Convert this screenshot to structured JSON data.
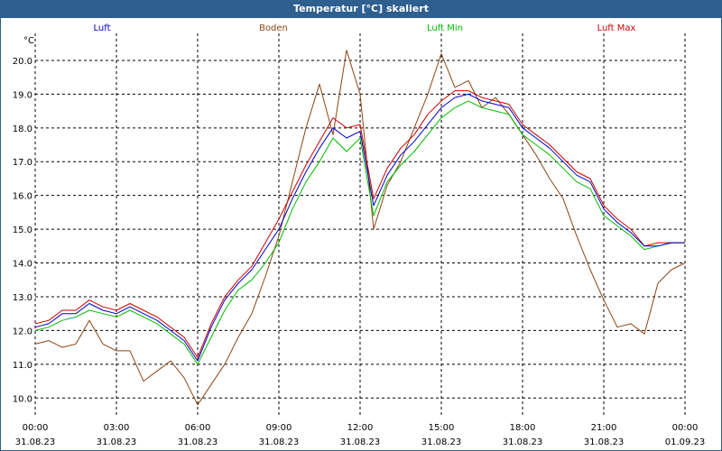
{
  "window": {
    "title": "Temperatur [°C] skaliert"
  },
  "legend": [
    {
      "label": "Luft",
      "color": "#0000cc"
    },
    {
      "label": "Boden",
      "color": "#8b4513"
    },
    {
      "label": "Luft Min",
      "color": "#00bb00"
    },
    {
      "label": "Luft Max",
      "color": "#cc0000"
    }
  ],
  "chart_data": {
    "type": "line",
    "ylabel": "°C",
    "ylim": [
      9.5,
      20.8
    ],
    "y_ticks": [
      "10.0",
      "11.0",
      "12.0",
      "13.0",
      "14.0",
      "15.0",
      "16.0",
      "17.0",
      "18.0",
      "19.0",
      "20.0"
    ],
    "xlim": [
      0,
      24
    ],
    "x_ticks": [
      {
        "time": "00:00",
        "date": "31.08.23"
      },
      {
        "time": "03:00",
        "date": "31.08.23"
      },
      {
        "time": "06:00",
        "date": "31.08.23"
      },
      {
        "time": "09:00",
        "date": "31.08.23"
      },
      {
        "time": "12:00",
        "date": "31.08.23"
      },
      {
        "time": "15:00",
        "date": "31.08.23"
      },
      {
        "time": "18:00",
        "date": "31.08.23"
      },
      {
        "time": "21:00",
        "date": "31.08.23"
      },
      {
        "time": "00:00",
        "date": "01.09.23"
      }
    ],
    "grid": true,
    "series": [
      {
        "name": "Luft",
        "color": "#0000cc",
        "points": [
          [
            0,
            12.1
          ],
          [
            0.5,
            12.2
          ],
          [
            1,
            12.5
          ],
          [
            1.5,
            12.5
          ],
          [
            2,
            12.8
          ],
          [
            2.5,
            12.6
          ],
          [
            3,
            12.5
          ],
          [
            3.5,
            12.7
          ],
          [
            4,
            12.5
          ],
          [
            4.5,
            12.3
          ],
          [
            5,
            12.0
          ],
          [
            5.5,
            11.7
          ],
          [
            6,
            11.1
          ],
          [
            6.5,
            12.1
          ],
          [
            7,
            12.9
          ],
          [
            7.5,
            13.4
          ],
          [
            8,
            13.8
          ],
          [
            8.5,
            14.4
          ],
          [
            9,
            15.0
          ],
          [
            9.5,
            15.9
          ],
          [
            10,
            16.7
          ],
          [
            10.5,
            17.4
          ],
          [
            11,
            18.0
          ],
          [
            11.5,
            17.7
          ],
          [
            12,
            17.9
          ],
          [
            12.5,
            15.7
          ],
          [
            13,
            16.6
          ],
          [
            13.5,
            17.2
          ],
          [
            14,
            17.6
          ],
          [
            14.5,
            18.1
          ],
          [
            15,
            18.6
          ],
          [
            15.5,
            18.9
          ],
          [
            16,
            19.0
          ],
          [
            16.5,
            18.8
          ],
          [
            17,
            18.7
          ],
          [
            17.5,
            18.6
          ],
          [
            18,
            18.0
          ],
          [
            18.5,
            17.7
          ],
          [
            19,
            17.4
          ],
          [
            19.5,
            17.0
          ],
          [
            20,
            16.6
          ],
          [
            20.5,
            16.4
          ],
          [
            21,
            15.6
          ],
          [
            21.5,
            15.2
          ],
          [
            22,
            14.9
          ],
          [
            22.5,
            14.5
          ],
          [
            23,
            14.5
          ],
          [
            23.5,
            14.6
          ],
          [
            24,
            14.6
          ]
        ]
      },
      {
        "name": "Boden",
        "color": "#8b4513",
        "points": [
          [
            0,
            11.6
          ],
          [
            0.5,
            11.7
          ],
          [
            1,
            11.5
          ],
          [
            1.5,
            11.6
          ],
          [
            2,
            12.3
          ],
          [
            2.5,
            11.6
          ],
          [
            3,
            11.4
          ],
          [
            3.5,
            11.4
          ],
          [
            4,
            10.5
          ],
          [
            4.5,
            10.8
          ],
          [
            5,
            11.1
          ],
          [
            5.5,
            10.6
          ],
          [
            6,
            9.8
          ],
          [
            6.5,
            10.4
          ],
          [
            7,
            11.0
          ],
          [
            7.5,
            11.8
          ],
          [
            8,
            12.5
          ],
          [
            8.5,
            13.6
          ],
          [
            9,
            14.8
          ],
          [
            9.5,
            16.4
          ],
          [
            10,
            18.0
          ],
          [
            10.5,
            19.3
          ],
          [
            11,
            17.8
          ],
          [
            11.5,
            20.3
          ],
          [
            12,
            19.0
          ],
          [
            12.5,
            15.0
          ],
          [
            13,
            16.3
          ],
          [
            13.5,
            17.0
          ],
          [
            14,
            18.0
          ],
          [
            14.5,
            19.0
          ],
          [
            15,
            20.2
          ],
          [
            15.5,
            19.2
          ],
          [
            16,
            19.4
          ],
          [
            16.5,
            18.6
          ],
          [
            17,
            18.9
          ],
          [
            17.5,
            18.4
          ],
          [
            18,
            17.8
          ],
          [
            18.5,
            17.2
          ],
          [
            19,
            16.5
          ],
          [
            19.5,
            15.9
          ],
          [
            20,
            14.8
          ],
          [
            20.5,
            13.8
          ],
          [
            21,
            12.9
          ],
          [
            21.5,
            12.1
          ],
          [
            22,
            12.2
          ],
          [
            22.5,
            11.9
          ],
          [
            23,
            13.4
          ],
          [
            23.5,
            13.8
          ],
          [
            24,
            14.0
          ]
        ]
      },
      {
        "name": "Luft Min",
        "color": "#00bb00",
        "points": [
          [
            0,
            12.0
          ],
          [
            0.5,
            12.1
          ],
          [
            1,
            12.3
          ],
          [
            1.5,
            12.4
          ],
          [
            2,
            12.6
          ],
          [
            2.5,
            12.5
          ],
          [
            3,
            12.4
          ],
          [
            3.5,
            12.6
          ],
          [
            4,
            12.4
          ],
          [
            4.5,
            12.2
          ],
          [
            5,
            11.9
          ],
          [
            5.5,
            11.6
          ],
          [
            6,
            11.0
          ],
          [
            6.5,
            11.8
          ],
          [
            7,
            12.6
          ],
          [
            7.5,
            13.2
          ],
          [
            8,
            13.5
          ],
          [
            8.5,
            14.0
          ],
          [
            9,
            14.6
          ],
          [
            9.5,
            15.6
          ],
          [
            10,
            16.4
          ],
          [
            10.5,
            17.0
          ],
          [
            11,
            17.7
          ],
          [
            11.5,
            17.3
          ],
          [
            12,
            17.7
          ],
          [
            12.5,
            15.4
          ],
          [
            13,
            16.4
          ],
          [
            13.5,
            16.9
          ],
          [
            14,
            17.3
          ],
          [
            14.5,
            17.8
          ],
          [
            15,
            18.3
          ],
          [
            15.5,
            18.6
          ],
          [
            16,
            18.8
          ],
          [
            16.5,
            18.6
          ],
          [
            17,
            18.5
          ],
          [
            17.5,
            18.4
          ],
          [
            18,
            17.8
          ],
          [
            18.5,
            17.5
          ],
          [
            19,
            17.2
          ],
          [
            19.5,
            16.8
          ],
          [
            20,
            16.4
          ],
          [
            20.5,
            16.2
          ],
          [
            21,
            15.4
          ],
          [
            21.5,
            15.1
          ],
          [
            22,
            14.8
          ],
          [
            22.5,
            14.4
          ],
          [
            23,
            14.5
          ],
          [
            23.5,
            14.6
          ],
          [
            24,
            14.6
          ]
        ]
      },
      {
        "name": "Luft Max",
        "color": "#cc0000",
        "points": [
          [
            0,
            12.2
          ],
          [
            0.5,
            12.3
          ],
          [
            1,
            12.6
          ],
          [
            1.5,
            12.6
          ],
          [
            2,
            12.9
          ],
          [
            2.5,
            12.7
          ],
          [
            3,
            12.6
          ],
          [
            3.5,
            12.8
          ],
          [
            4,
            12.6
          ],
          [
            4.5,
            12.4
          ],
          [
            5,
            12.1
          ],
          [
            5.5,
            11.8
          ],
          [
            6,
            11.2
          ],
          [
            6.5,
            12.2
          ],
          [
            7,
            13.0
          ],
          [
            7.5,
            13.5
          ],
          [
            8,
            13.9
          ],
          [
            8.5,
            14.6
          ],
          [
            9,
            15.3
          ],
          [
            9.5,
            16.1
          ],
          [
            10,
            16.9
          ],
          [
            10.5,
            17.6
          ],
          [
            11,
            18.3
          ],
          [
            11.5,
            18.0
          ],
          [
            12,
            18.1
          ],
          [
            12.5,
            15.9
          ],
          [
            13,
            16.8
          ],
          [
            13.5,
            17.4
          ],
          [
            14,
            17.8
          ],
          [
            14.5,
            18.4
          ],
          [
            15,
            18.8
          ],
          [
            15.5,
            19.1
          ],
          [
            16,
            19.1
          ],
          [
            16.5,
            18.9
          ],
          [
            17,
            18.8
          ],
          [
            17.5,
            18.7
          ],
          [
            18,
            18.1
          ],
          [
            18.5,
            17.8
          ],
          [
            19,
            17.5
          ],
          [
            19.5,
            17.1
          ],
          [
            20,
            16.7
          ],
          [
            20.5,
            16.5
          ],
          [
            21,
            15.7
          ],
          [
            21.5,
            15.3
          ],
          [
            22,
            15.0
          ],
          [
            22.5,
            14.5
          ],
          [
            23,
            14.6
          ],
          [
            23.5,
            14.6
          ],
          [
            24,
            14.6
          ]
        ]
      }
    ]
  }
}
